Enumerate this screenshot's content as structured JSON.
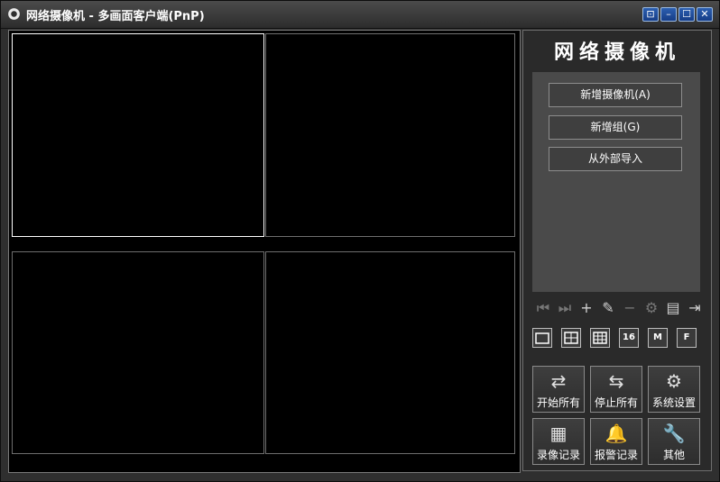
{
  "window": {
    "title": "网络摄像机 - 多画面客户端(PnP)",
    "controls": {
      "restore": "⊡",
      "minimize": "–",
      "maximize": "☐",
      "close": "✕"
    }
  },
  "sidebar": {
    "brand": "网络摄像机",
    "buttons": {
      "add_camera": "新增摄像机(A)",
      "add_group": "新增组(G)",
      "import": "从外部导入"
    },
    "toolbar": {
      "first": "⏮",
      "next": "⏭",
      "add": "+",
      "edit": "✎",
      "remove": "−",
      "settings": "⚙",
      "export": "▤",
      "exit": "⇥"
    },
    "layouts": {
      "single": "",
      "four": "",
      "nine": "",
      "sixteen": "16",
      "m": "M",
      "f": "F"
    },
    "actions": {
      "start_all": "开始所有",
      "stop_all": "停止所有",
      "system_settings": "系统设置",
      "recordings": "录像记录",
      "alarm_log": "报警记录",
      "other": "其他"
    },
    "action_icons": {
      "start_all": "⇄",
      "stop_all": "⇆",
      "system_settings": "⚙",
      "recordings": "▦",
      "alarm_log": "🔔",
      "other": "🔧"
    }
  },
  "colors": {
    "title_bar": "#3a3a3a",
    "panel": "#4a4a4a",
    "active_pane_border": "#ffffff",
    "window_button": "#1e4c9c"
  }
}
